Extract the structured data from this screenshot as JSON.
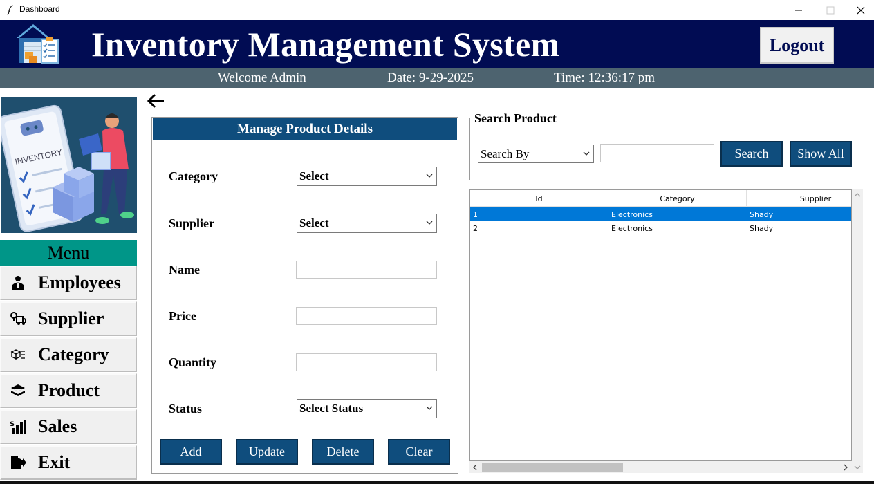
{
  "window": {
    "title": "Dashboard"
  },
  "header": {
    "title": "Inventory Management System",
    "logout_label": "Logout"
  },
  "subheader": {
    "welcome": "Welcome Admin",
    "date": "Date: 9-29-2025",
    "time": "Time: 12:36:17 pm"
  },
  "sidebar": {
    "menu_title": "Menu",
    "items": [
      {
        "label": "Employees",
        "icon": "user-icon"
      },
      {
        "label": "Supplier",
        "icon": "supplier-icon"
      },
      {
        "label": "Category",
        "icon": "category-icon"
      },
      {
        "label": "Product",
        "icon": "product-icon"
      },
      {
        "label": "Sales",
        "icon": "sales-icon"
      },
      {
        "label": "Exit",
        "icon": "exit-icon"
      }
    ]
  },
  "form": {
    "title": "Manage Product Details",
    "category_label": "Category",
    "category_value": "Select",
    "supplier_label": "Supplier",
    "supplier_value": "Select",
    "name_label": "Name",
    "name_value": "",
    "price_label": "Price",
    "price_value": "",
    "quantity_label": "Quantity",
    "quantity_value": "",
    "status_label": "Status",
    "status_value": "Select Status",
    "buttons": {
      "add": "Add",
      "update": "Update",
      "delete": "Delete",
      "clear": "Clear"
    }
  },
  "search": {
    "title": "Search Product",
    "search_by": "Search By",
    "query": "",
    "search_label": "Search",
    "show_all_label": "Show All"
  },
  "table": {
    "columns": [
      "Id",
      "Category",
      "Supplier"
    ],
    "rows": [
      {
        "id": "1",
        "category": "Electronics",
        "supplier": "Shady",
        "selected": true
      },
      {
        "id": "2",
        "category": "Electronics",
        "supplier": "Shady",
        "selected": false
      }
    ]
  },
  "colors": {
    "header_bg": "#010c53",
    "subheader_bg": "#4d636f",
    "accent": "#0f4d7d",
    "menu_header": "#009688",
    "selection": "#0078d7"
  }
}
